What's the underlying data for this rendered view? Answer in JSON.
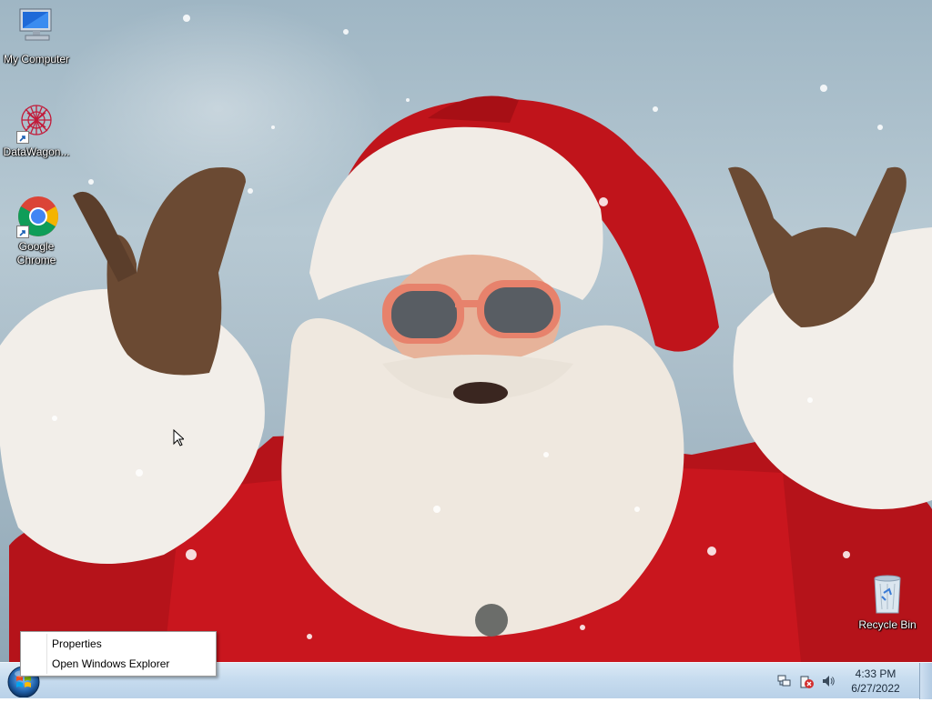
{
  "desktop": {
    "icons": [
      {
        "label": "My Computer",
        "icon": "computer-icon"
      },
      {
        "label": "DataWagon...",
        "icon": "datawagon-icon"
      },
      {
        "label": "Google Chrome",
        "icon": "chrome-icon"
      },
      {
        "label": "Recycle Bin",
        "icon": "recycle-bin-icon"
      }
    ],
    "wallpaper": "santa-claus-wallpaper"
  },
  "context_menu": {
    "items": [
      "Properties",
      "Open Windows Explorer"
    ]
  },
  "taskbar": {
    "start_icon": "windows-start-orb",
    "tray_icons": [
      "network-icon",
      "action-center-icon",
      "volume-icon"
    ],
    "clock": {
      "time": "4:33 PM",
      "date": "6/27/2022"
    }
  },
  "colors": {
    "santa_red": "#c0141b",
    "taskbar": "#c7dcef",
    "menu_border": "#9a9a9a"
  }
}
